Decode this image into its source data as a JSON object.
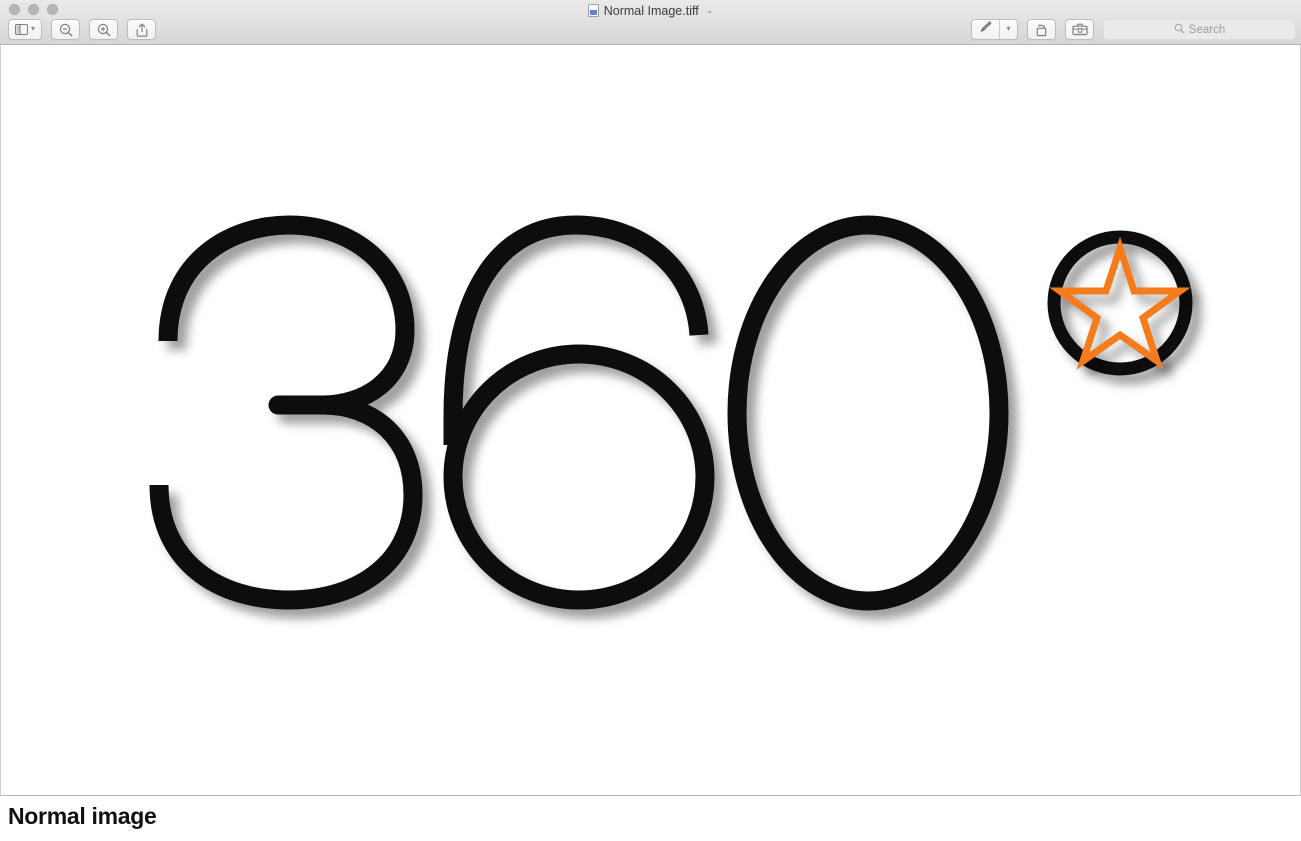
{
  "window": {
    "title": "Normal Image.tiff",
    "title_icon": "tiff-document-icon",
    "title_chevron": "⌄",
    "traffic_lights": [
      {
        "name": "close",
        "color": "#b6b6b6"
      },
      {
        "name": "minimize",
        "color": "#b6b6b6"
      },
      {
        "name": "zoom",
        "color": "#b6b6b6"
      }
    ]
  },
  "toolbar": {
    "left_items": [
      {
        "name": "sidebar-toggle-button",
        "icon": "sidebar-icon",
        "chevron": "⌄"
      },
      {
        "name": "zoom-out-button",
        "icon": "magnifier-minus-icon"
      },
      {
        "name": "zoom-in-button",
        "icon": "magnifier-plus-icon"
      },
      {
        "name": "share-button",
        "icon": "share-icon"
      }
    ],
    "right_items": [
      {
        "name": "markup-pen-button",
        "icon": "pen-icon",
        "chevron": "⌄"
      },
      {
        "name": "rotate-left-button",
        "icon": "rotate-left-icon"
      },
      {
        "name": "markup-toolbox-button",
        "icon": "toolbox-icon"
      }
    ]
  },
  "search": {
    "placeholder": "Search",
    "value": "",
    "icon": "search-icon"
  },
  "artwork": {
    "text": "360",
    "digits": [
      "3",
      "6",
      "0"
    ],
    "degree_symbol": {
      "name": "degree-circle-with-star",
      "outer_shape": "circle",
      "outer_stroke_color": "#000000",
      "inner_shape": "star",
      "inner_stroke_color": "#F57C1F",
      "star_points": 5
    },
    "stroke_color": "#000000",
    "background_color": "#FFFFFF",
    "has_drop_shadow": true
  },
  "caption": {
    "text": "Normal image"
  },
  "colors": {
    "accent_orange": "#F57C1F",
    "ink_black": "#000000",
    "toolbar_top": "#E9E9E9",
    "toolbar_bottom": "#D6D6D6",
    "canvas_white": "#FFFFFF"
  }
}
